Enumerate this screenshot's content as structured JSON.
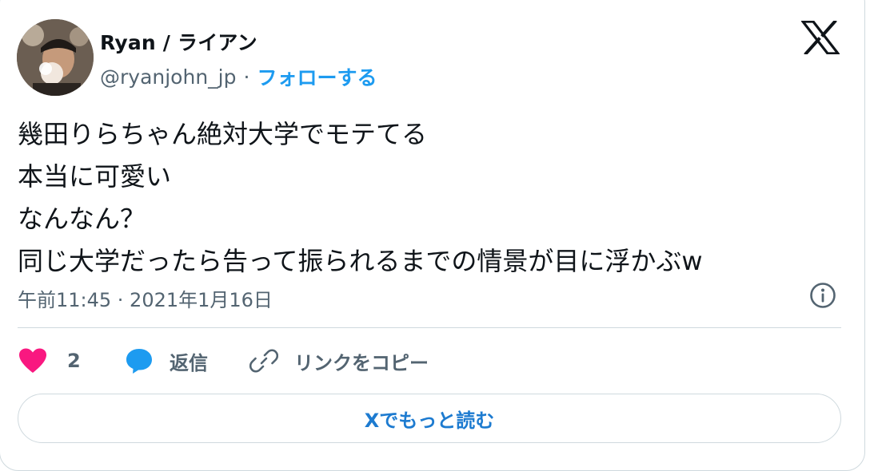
{
  "author": {
    "display_name": "Ryan / ライアン",
    "handle": "@ryanjohn_jp",
    "separator": "·",
    "follow_label": "フォローする"
  },
  "tweet": {
    "lines": [
      "幾田りらちゃん絶対大学でモテてる",
      "本当に可愛い",
      "なんなん？",
      "同じ大学だったら告って振られるまでの情景が目に浮かぶw"
    ],
    "timestamp": "午前11:45 · 2021年1月16日"
  },
  "actions": {
    "like_count": "2",
    "reply_label": "返信",
    "copy_link_label": "リンクをコピー"
  },
  "read_more_label": "Xでもっと読む",
  "colors": {
    "accent": "#1d9bf0",
    "like": "#f91880",
    "secondary_text": "#536471",
    "border": "#cfd9de"
  },
  "icons": {
    "brand": "x-logo-icon",
    "info": "info-icon",
    "like": "heart-icon",
    "reply": "speech-bubble-icon",
    "copy": "link-icon"
  }
}
